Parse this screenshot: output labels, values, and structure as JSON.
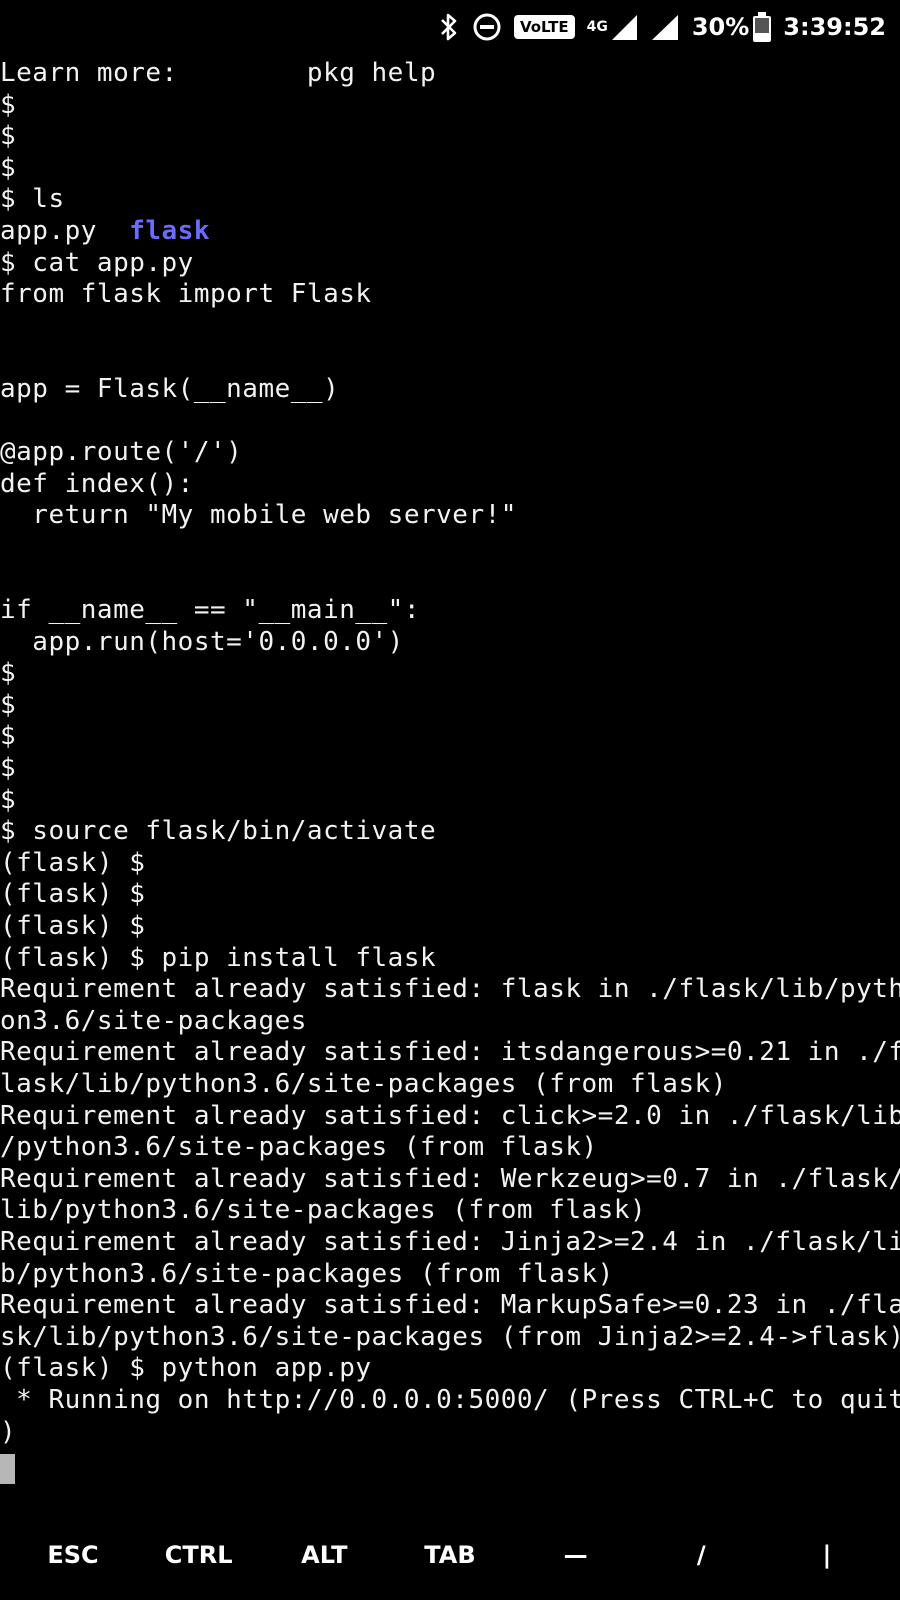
{
  "status_bar": {
    "bluetooth_icon": "bluetooth-icon",
    "dnd_icon": "do-not-disturb-icon",
    "volte": "VoLTE",
    "network_type": "4G",
    "battery_percent": "30%",
    "battery_level": 0.3,
    "time": "3:39:52"
  },
  "terminal": {
    "lines": [
      "Learn more:        pkg help",
      "$",
      "$",
      "$",
      "$ ls",
      "app.py  ",
      "$ cat app.py",
      "from flask import Flask",
      "",
      "",
      "app = Flask(__name__)",
      "",
      "@app.route('/')",
      "def index():",
      "  return \"My mobile web server!\"",
      "",
      "",
      "if __name__ == \"__main__\":",
      "  app.run(host='0.0.0.0')",
      "$",
      "$",
      "$",
      "$",
      "$",
      "$ source flask/bin/activate",
      "(flask) $",
      "(flask) $",
      "(flask) $",
      "(flask) $ pip install flask",
      "Requirement already satisfied: flask in ./flask/lib/pyth",
      "on3.6/site-packages",
      "Requirement already satisfied: itsdangerous>=0.21 in ./f",
      "lask/lib/python3.6/site-packages (from flask)",
      "Requirement already satisfied: click>=2.0 in ./flask/lib",
      "/python3.6/site-packages (from flask)",
      "Requirement already satisfied: Werkzeug>=0.7 in ./flask/",
      "lib/python3.6/site-packages (from flask)",
      "Requirement already satisfied: Jinja2>=2.4 in ./flask/li",
      "b/python3.6/site-packages (from flask)",
      "Requirement already satisfied: MarkupSafe>=0.23 in ./fla",
      "sk/lib/python3.6/site-packages (from Jinja2>=2.4->flask)",
      "(flask) $ python app.py",
      " * Running on http://0.0.0.0:5000/ (Press CTRL+C to quit",
      ")"
    ],
    "dir_entry": "flask",
    "dir_color": "#6b6bff"
  },
  "extra_keys": [
    "ESC",
    "CTRL",
    "ALT",
    "TAB",
    "—",
    "/",
    "|"
  ]
}
